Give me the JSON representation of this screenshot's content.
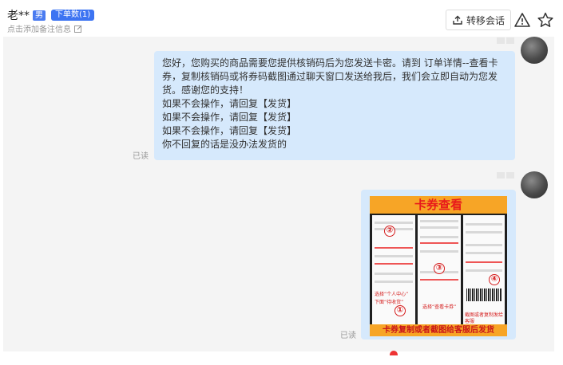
{
  "header": {
    "customer_name": "老**",
    "gender_badge": "男",
    "orders_badge": "下单数(1)",
    "remark_placeholder": "点击添加备注信息",
    "transfer_button": "转移会话",
    "icons": [
      "edit-icon",
      "transfer-icon",
      "warning-icon",
      "star-icon"
    ]
  },
  "messages": [
    {
      "type": "text",
      "lines": [
        "您好，您购买的商品需要您提供核销码后为您发送卡密。请到 订单详情--查看卡",
        "券，复制核销码或将券码截图通过聊天窗口发送给我后，我们会立即自动为您发",
        "货。感谢您的支持！",
        "如果不会操作，请回复【发货】",
        "如果不会操作，请回复【发货】",
        "如果不会操作，请回复【发货】",
        "你不回复的话是没办法发货的"
      ],
      "status": "已读"
    },
    {
      "type": "image",
      "image_title": "卡券查看",
      "image_footer": "卡券复制或者截图给客服后发货",
      "step_numbers": [
        "①",
        "②",
        "③",
        "④"
      ],
      "captions": [
        "选择“个人中心”",
        "下面“待收货”",
        "选择“查看卡券”",
        "截图或者复制发给客服"
      ],
      "status": "已读"
    }
  ],
  "colors": {
    "bubble": "#d6e9fc",
    "chat_bg": "#f4f4f4",
    "accent_blue": "#3d74f2",
    "banner_orange": "#f7a526",
    "banner_red": "#e81b1b"
  }
}
